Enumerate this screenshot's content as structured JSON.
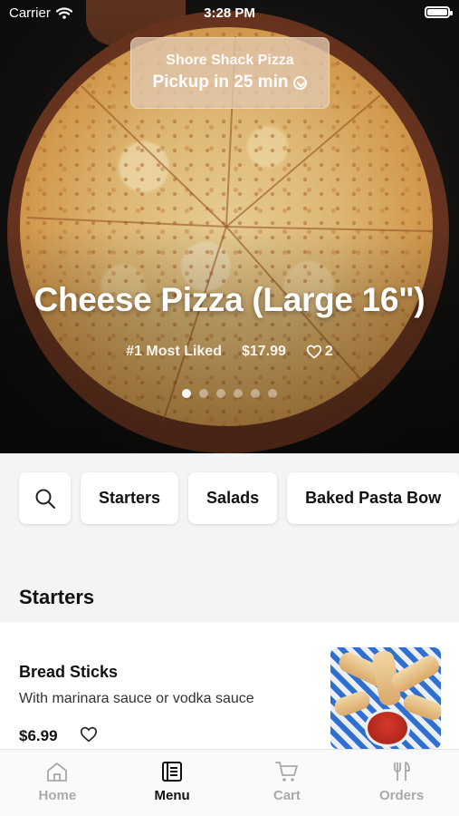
{
  "status_bar": {
    "carrier": "Carrier",
    "time": "3:28 PM"
  },
  "pickup": {
    "restaurant": "Shore Shack Pizza",
    "eta": "Pickup in 25 min"
  },
  "featured": {
    "title": "Cheese Pizza (Large 16\")",
    "badge": "#1 Most Liked",
    "price": "$17.99",
    "likes": "2",
    "carousel_pages": 6,
    "active_page": 1
  },
  "categories": [
    "Starters",
    "Salads",
    "Baked Pasta Bow"
  ],
  "section": {
    "title": "Starters"
  },
  "menu_item": {
    "name": "Bread Sticks",
    "description": "With marinara sauce or vodka sauce",
    "price": "$6.99"
  },
  "tabs": [
    {
      "label": "Home",
      "icon": "home-icon",
      "active": false
    },
    {
      "label": "Menu",
      "icon": "menu-book-icon",
      "active": true
    },
    {
      "label": "Cart",
      "icon": "cart-icon",
      "active": false
    },
    {
      "label": "Orders",
      "icon": "fork-knife-icon",
      "active": false
    }
  ]
}
